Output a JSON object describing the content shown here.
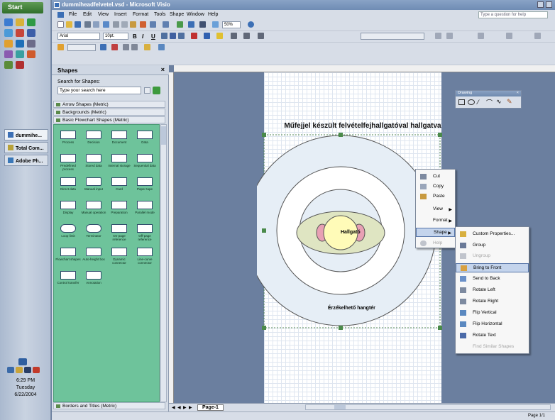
{
  "taskbar": {
    "start_label": "Start",
    "windows": [
      "dummihe...",
      "Total Com...",
      "Adobe Ph..."
    ],
    "clock": {
      "time": "6:29 PM",
      "day": "Tuesday",
      "date": "6/22/2004"
    }
  },
  "window": {
    "title": "dummiheadfelvetel.vsd - Microsoft Visio",
    "menu": [
      "File",
      "Edit",
      "View",
      "Insert",
      "Format",
      "Tools",
      "Shape",
      "Window",
      "Help"
    ],
    "help_placeholder": "Type a question for help"
  },
  "toolbar": {
    "font": "Arial",
    "font_size": "10pt.",
    "zoom": "50%",
    "bold": "B",
    "italic": "I",
    "underline": "U"
  },
  "shapes_pane": {
    "title": "Shapes",
    "search_label": "Search for Shapes:",
    "search_placeholder": "Type your search here",
    "stencils": [
      "Arrow Shapes (Metric)",
      "Backgrounds (Metric)",
      "Basic Flowchart Shapes (Metric)"
    ],
    "bottom_stencil": "Borders and Titles (Metric)",
    "masters": [
      "Process",
      "Decision",
      "Document",
      "Data",
      "Predefined process",
      "Stored data",
      "Internal storage",
      "Sequential data",
      "Direct data",
      "Manual input",
      "Card",
      "Paper tape",
      "Display",
      "Manual operation",
      "Preparation",
      "Parallel mode",
      "Loop limit",
      "Terminator",
      "On-page reference",
      "Off-page reference",
      "Flowchart shapes",
      "Auto-height box",
      "Dynamic connector",
      "Line-curve connector",
      "Control transfer",
      "Annotation"
    ]
  },
  "drawing": {
    "title": "Műfejjel készült felvételfejhallgatóval hallgatva",
    "center_label": "Hallgató",
    "bottom_label": "Érzékelhető hangtér"
  },
  "drawing_toolbar": {
    "title": "Drawing"
  },
  "context_menu": {
    "items": [
      "Cut",
      "Copy",
      "Paste",
      "View",
      "Format",
      "Shape",
      "Help"
    ]
  },
  "shape_submenu": {
    "items": [
      "Custom Properties...",
      "Group",
      "Ungroup",
      "Bring to Front",
      "Send to Back",
      "Rotate Left",
      "Rotate Right",
      "Flip Vertical",
      "Flip Horizontal",
      "Rotate Text",
      "Find Similar Shapes"
    ]
  },
  "page_tabs": {
    "current": "Page-1"
  },
  "status": {
    "page": "Page 1/1"
  }
}
